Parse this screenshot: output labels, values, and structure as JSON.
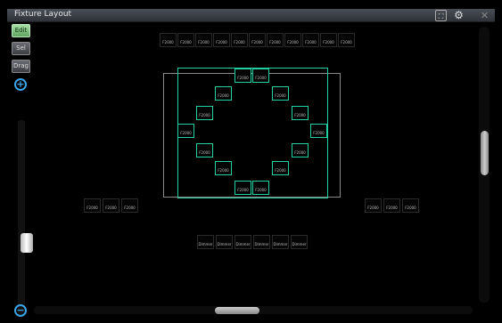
{
  "window": {
    "title": "Fixture Layout"
  },
  "titlebar_icons": {
    "fit": "fit-view-icon",
    "settings": "gear-icon",
    "close": "close-icon",
    "close_glyph": "✕"
  },
  "toolbar": {
    "buttons": [
      {
        "name": "edit-button",
        "label": "Edit",
        "active": true
      },
      {
        "name": "select-button",
        "label": "Sel",
        "active": false
      },
      {
        "name": "drag-button",
        "label": "Drag",
        "active": false
      }
    ],
    "zoom_in_glyph": "+",
    "zoom_out_glyph": "−",
    "zoom_level": 0.34
  },
  "scroll": {
    "vertical": 0.45,
    "horizontal": 0.5
  },
  "fixtures": {
    "top_row": [
      "F2000",
      "F2000",
      "F2000",
      "F2000",
      "F2000",
      "F2000",
      "F2000",
      "F2000",
      "F2000",
      "F2000",
      "F2000"
    ],
    "diamond": [
      "F2000",
      "F2000",
      "F2000",
      "F2000",
      "F2000",
      "F2000",
      "F2000",
      "F2000",
      "F2000",
      "F2000",
      "F2000",
      "F2000",
      "F2000",
      "F2000",
      "F2000",
      "F2000"
    ],
    "left_row": [
      "F2000",
      "F2000",
      "F2000"
    ],
    "right_row": [
      "F2000",
      "F2000",
      "F2000"
    ],
    "bottom_row": [
      "Dimmer",
      "Dimmer",
      "Dimmer",
      "Dimmer",
      "Dimmer",
      "Dimmer"
    ]
  },
  "accent_color": "#1fd1a2"
}
